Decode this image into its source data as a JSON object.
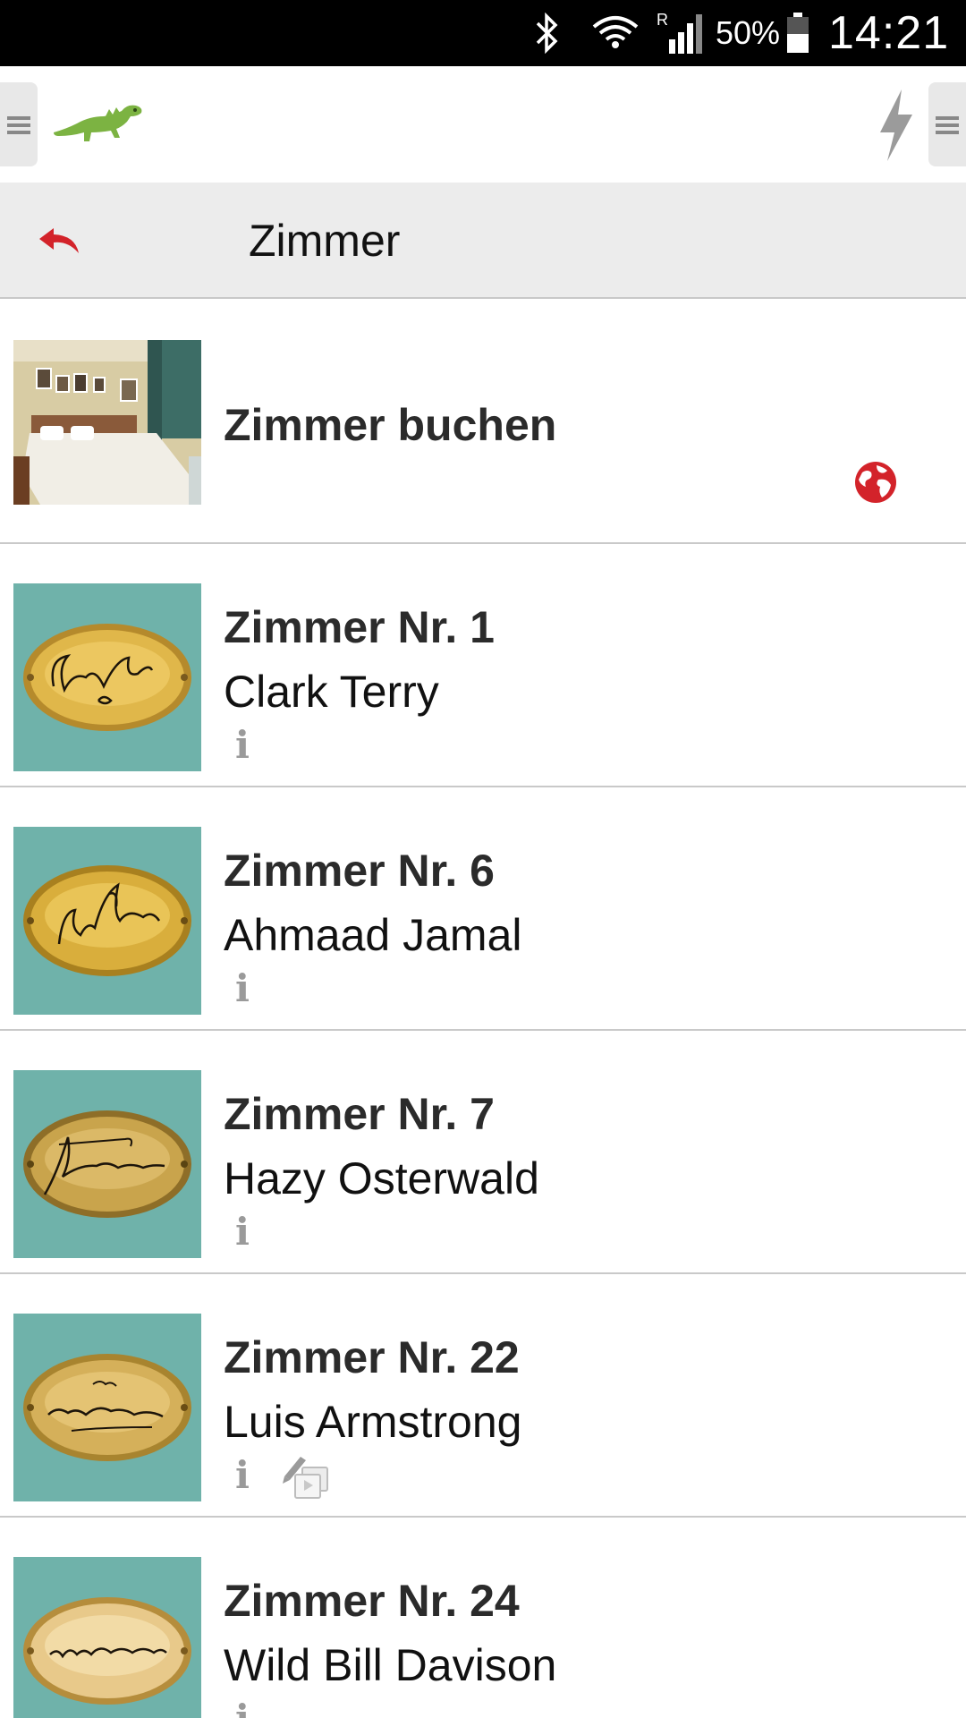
{
  "status_bar": {
    "battery_text": "50%",
    "time": "14:21"
  },
  "header": {
    "title": "Zimmer"
  },
  "booking": {
    "title": "Zimmer buchen",
    "web_icon": "globe-icon"
  },
  "rooms": [
    {
      "title": "Zimmer Nr. 1",
      "name": "Clark Terry",
      "info_icon": "i",
      "signature": "Clark Terry"
    },
    {
      "title": "Zimmer Nr. 6",
      "name": "Ahmaad Jamal",
      "info_icon": "i",
      "signature": "Ahmad Jamal"
    },
    {
      "title": "Zimmer Nr. 7",
      "name": "Hazy Osterwald",
      "info_icon": "i",
      "signature": "Hazy Osterwald"
    },
    {
      "title": "Zimmer Nr. 22",
      "name": "Luis Armstrong",
      "info_icon": "i",
      "signature": "Louis Armstrong",
      "has_media": true
    },
    {
      "title": "Zimmer Nr. 24",
      "name": "Wild Bill Davison",
      "info_icon": "i",
      "signature": "Wild Bill Davison"
    }
  ],
  "colors": {
    "accent_red": "#d3232a",
    "logo_green": "#7cb342",
    "plaque_bg": "#6fb2aa",
    "header_bg": "#ececec"
  }
}
